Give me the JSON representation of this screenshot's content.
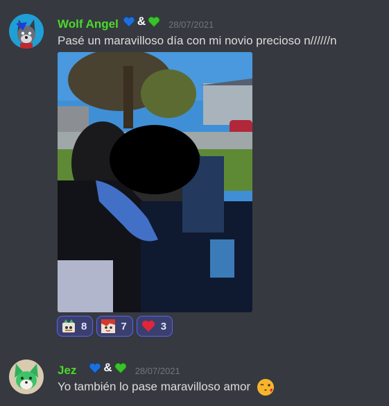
{
  "messages": [
    {
      "author": "Wolf Angel",
      "badges": "&",
      "timestamp": "28/07/2021",
      "text": "Pasé un maravilloso día con mi novio precioso n//////n",
      "avatar_icon": "wolf-avatar-icon",
      "reactions": [
        {
          "icon": "sticker-emoji-icon",
          "count": "8"
        },
        {
          "icon": "anime-emoji-icon",
          "count": "7"
        },
        {
          "icon": "red-heart-icon",
          "count": "3"
        }
      ]
    },
    {
      "author": "Jez",
      "badges": "&",
      "timestamp": "28/07/2021",
      "text": "Yo también lo pase maravilloso amor",
      "avatar_icon": "green-fox-avatar-icon",
      "trailing_emoji": "face-blowing-kiss-icon"
    }
  ],
  "colors": {
    "background": "#36393f",
    "username": "#4cd92b",
    "timestamp": "#72767d",
    "text": "#dcddde",
    "reaction_bg": "#3b3f6e",
    "reaction_border": "#5865f2",
    "blue_heart": "#1e6fd9",
    "green_heart": "#39c22b",
    "red_heart": "#e0263a"
  }
}
